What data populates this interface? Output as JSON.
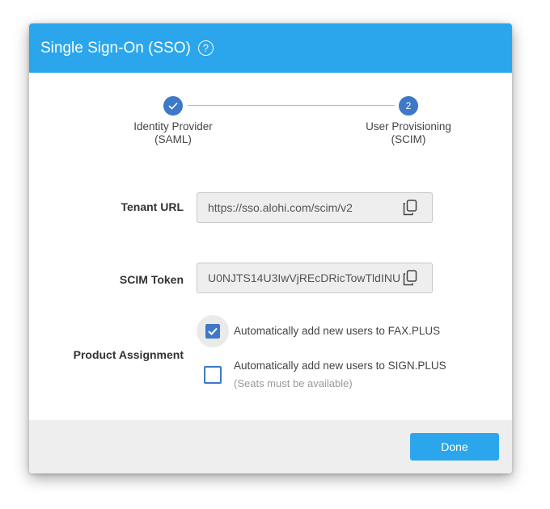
{
  "dialog": {
    "title": "Single Sign-On (SSO)",
    "help_icon": "?"
  },
  "stepper": {
    "steps": [
      {
        "icon": "check-icon",
        "label_line1": "Identity Provider",
        "label_line2": "(SAML)",
        "state": "completed"
      },
      {
        "number": "2",
        "label_line1": "User Provisioning",
        "label_line2": "(SCIM)",
        "state": "active"
      }
    ]
  },
  "fields": {
    "tenant_url": {
      "label": "Tenant URL",
      "value": "https://sso.alohi.com/scim/v2",
      "icon": "copy-icon"
    },
    "scim_token": {
      "label": "SCIM Token",
      "value": "U0NJTS14U3IwVjREcDRicTowTldINU",
      "icon": "copy-icon"
    }
  },
  "product_assignment": {
    "label": "Product Assignment",
    "options": [
      {
        "label": "Automatically add new users to FAX.PLUS",
        "checked": true
      },
      {
        "label": "Automatically add new users to SIGN.PLUS",
        "sublabel": "(Seats must be available)",
        "checked": false
      }
    ]
  },
  "footer": {
    "done_label": "Done"
  },
  "colors": {
    "accent": "#2ba6ec",
    "step": "#3e78c8",
    "footer_bg": "#eeeeee"
  }
}
